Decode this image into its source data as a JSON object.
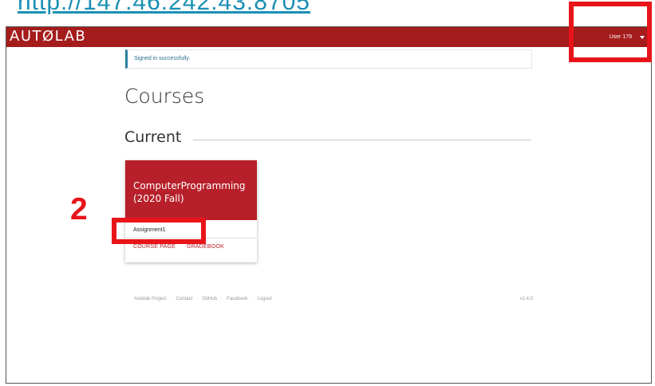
{
  "top_url": "http://147.46.242.43:8705",
  "navbar": {
    "brand": "AUTØLAB",
    "user": "User 179"
  },
  "alert": {
    "text": "Signed in successfully."
  },
  "page": {
    "title": "Courses",
    "section": "Current"
  },
  "course_card": {
    "title_line1": "ComputerProgramming",
    "title_line2": "(2020 Fall)",
    "assignment": "Assignment1",
    "links": [
      "COURSE PAGE",
      "GRADEBOOK"
    ]
  },
  "footer": {
    "links": [
      "Autolab Project",
      "Contact",
      "GitHub",
      "Facebook",
      "Logout"
    ],
    "separator": "·",
    "version": "v2.4.0"
  },
  "annotation": {
    "step_label": "2",
    "color": "#e8141a"
  },
  "colors": {
    "navbar": "#a51c1c",
    "card_header": "#b7202a",
    "alert_accent": "#2a7fa3"
  }
}
